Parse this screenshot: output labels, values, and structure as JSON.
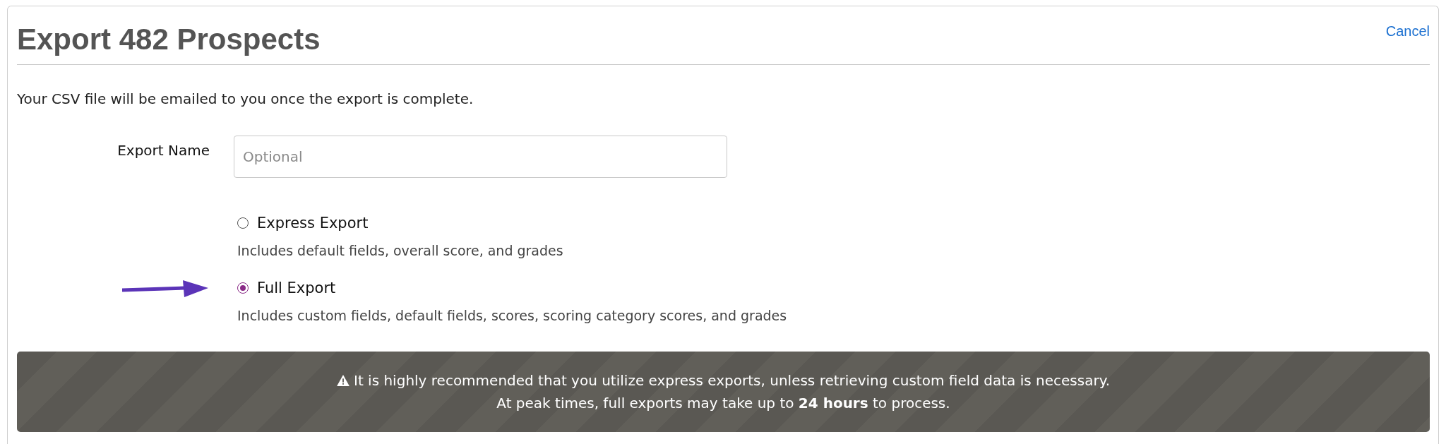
{
  "title": "Export 482 Prospects",
  "cancel": "Cancel",
  "description": "Your CSV file will be emailed to you once the export is complete.",
  "export_name": {
    "label": "Export Name",
    "placeholder": "Optional"
  },
  "options": [
    {
      "label": "Express Export",
      "description": "Includes default fields, overall score, and grades",
      "selected": false,
      "pointer": false
    },
    {
      "label": "Full Export",
      "description": "Includes custom fields, default fields, scores, scoring category scores, and grades",
      "selected": true,
      "pointer": true
    }
  ],
  "notice": {
    "lines": [
      "It is highly recommended that you utilize express exports, unless retrieving custom field data is necessary.",
      "At peak times, full exports may take up to **24 hours** to process."
    ]
  }
}
